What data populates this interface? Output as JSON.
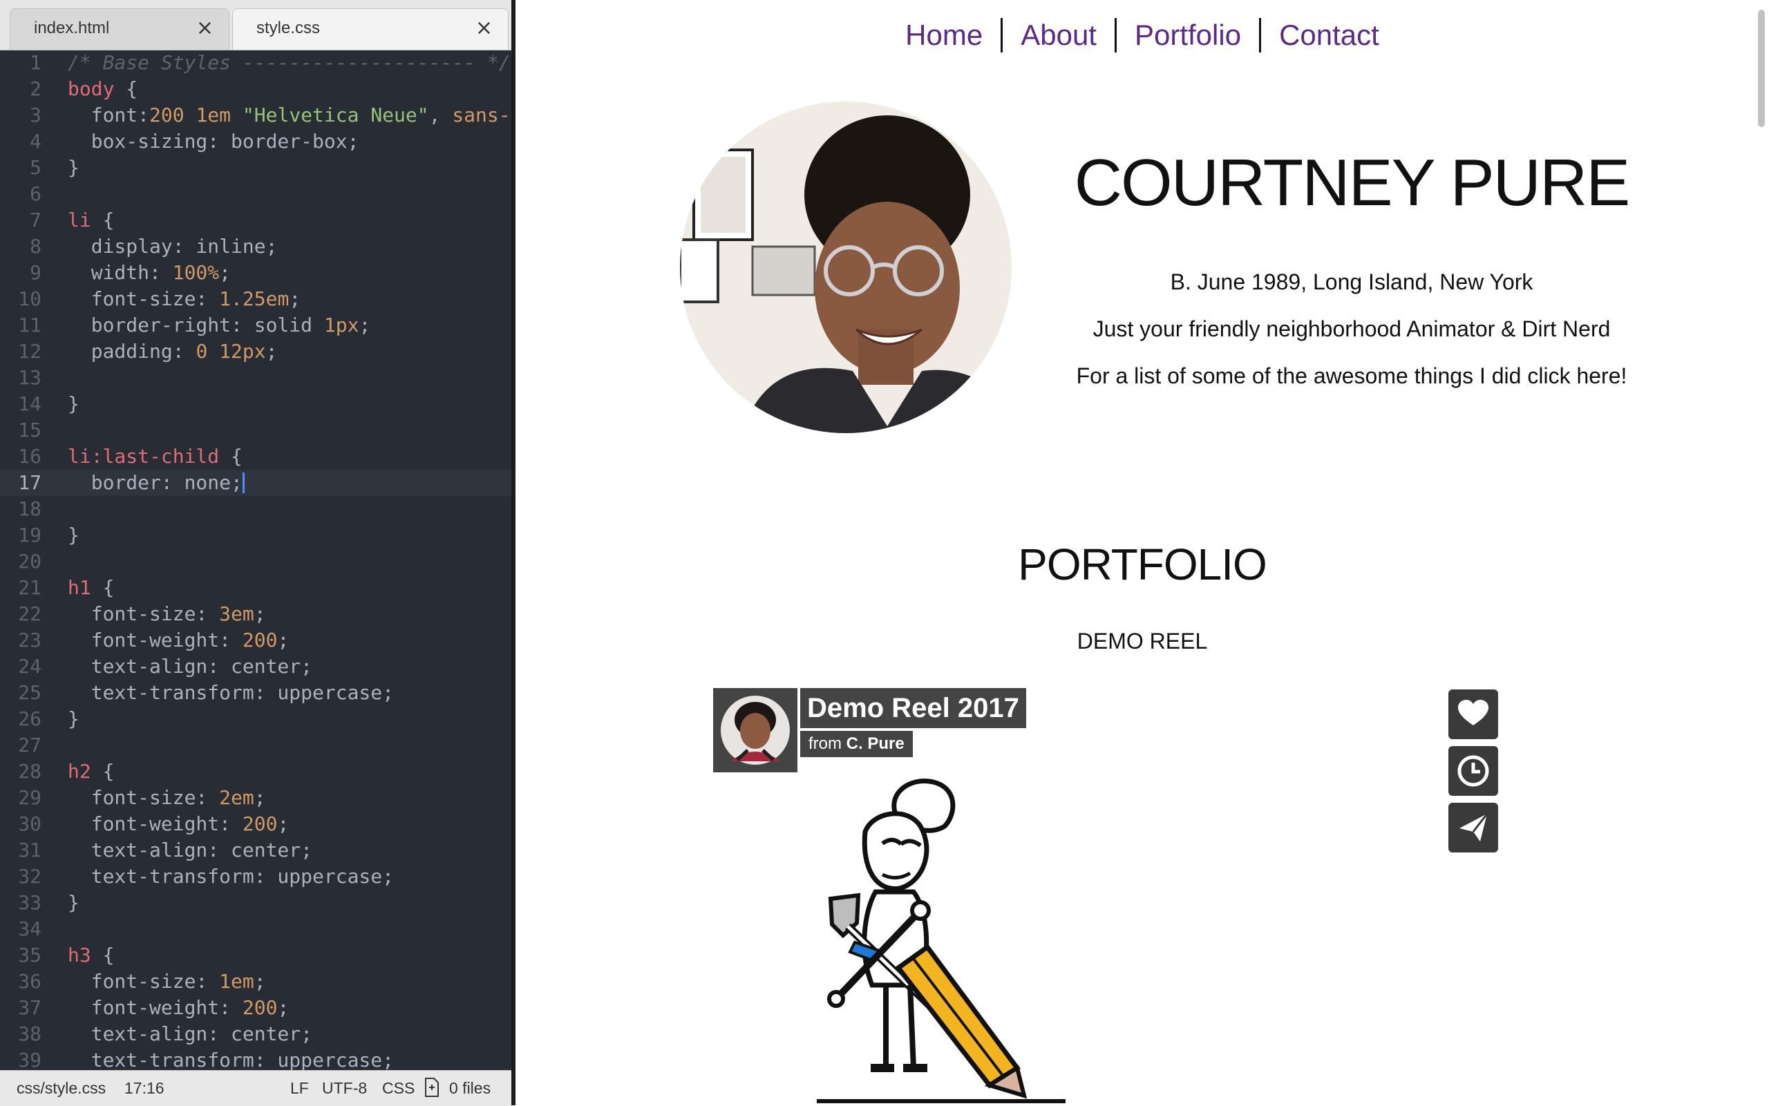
{
  "editor": {
    "tabs": [
      {
        "label": "index.html",
        "close": "×"
      },
      {
        "label": "style.css",
        "close": "×"
      }
    ],
    "lines": [
      {
        "n": "1",
        "parts": [
          {
            "c": "cm",
            "t": "/* Base Styles -------------------- */"
          }
        ]
      },
      {
        "n": "2",
        "parts": [
          {
            "c": "sel",
            "t": "body"
          },
          {
            "c": "",
            "t": " {"
          }
        ]
      },
      {
        "n": "3",
        "parts": [
          {
            "c": "",
            "t": "  font:"
          },
          {
            "c": "num",
            "t": "200 1em"
          },
          {
            "c": "",
            "t": " "
          },
          {
            "c": "str",
            "t": "\"Helvetica Neue\""
          },
          {
            "c": "",
            "t": ", "
          },
          {
            "c": "num",
            "t": "sans-ser"
          }
        ]
      },
      {
        "n": "4",
        "parts": [
          {
            "c": "",
            "t": "  box-sizing: border-box;"
          }
        ]
      },
      {
        "n": "5",
        "parts": [
          {
            "c": "",
            "t": "}"
          }
        ]
      },
      {
        "n": "6",
        "parts": []
      },
      {
        "n": "7",
        "parts": [
          {
            "c": "sel",
            "t": "li"
          },
          {
            "c": "",
            "t": " {"
          }
        ]
      },
      {
        "n": "8",
        "parts": [
          {
            "c": "",
            "t": "  display: inline;"
          }
        ]
      },
      {
        "n": "9",
        "parts": [
          {
            "c": "",
            "t": "  width: "
          },
          {
            "c": "num",
            "t": "100%"
          },
          {
            "c": "",
            "t": ";"
          }
        ]
      },
      {
        "n": "10",
        "parts": [
          {
            "c": "",
            "t": "  font-size: "
          },
          {
            "c": "num",
            "t": "1.25em"
          },
          {
            "c": "",
            "t": ";"
          }
        ]
      },
      {
        "n": "11",
        "parts": [
          {
            "c": "",
            "t": "  border-right: solid "
          },
          {
            "c": "num",
            "t": "1px"
          },
          {
            "c": "",
            "t": ";"
          }
        ]
      },
      {
        "n": "12",
        "parts": [
          {
            "c": "",
            "t": "  padding: "
          },
          {
            "c": "num",
            "t": "0 12px"
          },
          {
            "c": "",
            "t": ";"
          }
        ]
      },
      {
        "n": "13",
        "parts": []
      },
      {
        "n": "14",
        "parts": [
          {
            "c": "",
            "t": "}"
          }
        ]
      },
      {
        "n": "15",
        "parts": []
      },
      {
        "n": "16",
        "parts": [
          {
            "c": "sel",
            "t": "li:last-child"
          },
          {
            "c": "",
            "t": " {"
          }
        ]
      },
      {
        "n": "17",
        "parts": [
          {
            "c": "",
            "t": "  border: none;"
          }
        ],
        "current": true
      },
      {
        "n": "18",
        "parts": []
      },
      {
        "n": "19",
        "parts": [
          {
            "c": "",
            "t": "}"
          }
        ]
      },
      {
        "n": "20",
        "parts": []
      },
      {
        "n": "21",
        "parts": [
          {
            "c": "sel",
            "t": "h1"
          },
          {
            "c": "",
            "t": " {"
          }
        ]
      },
      {
        "n": "22",
        "parts": [
          {
            "c": "",
            "t": "  font-size: "
          },
          {
            "c": "num",
            "t": "3em"
          },
          {
            "c": "",
            "t": ";"
          }
        ]
      },
      {
        "n": "23",
        "parts": [
          {
            "c": "",
            "t": "  font-weight: "
          },
          {
            "c": "num",
            "t": "200"
          },
          {
            "c": "",
            "t": ";"
          }
        ]
      },
      {
        "n": "24",
        "parts": [
          {
            "c": "",
            "t": "  text-align: center;"
          }
        ]
      },
      {
        "n": "25",
        "parts": [
          {
            "c": "",
            "t": "  text-transform: uppercase;"
          }
        ]
      },
      {
        "n": "26",
        "parts": [
          {
            "c": "",
            "t": "}"
          }
        ]
      },
      {
        "n": "27",
        "parts": []
      },
      {
        "n": "28",
        "parts": [
          {
            "c": "sel",
            "t": "h2"
          },
          {
            "c": "",
            "t": " {"
          }
        ]
      },
      {
        "n": "29",
        "parts": [
          {
            "c": "",
            "t": "  font-size: "
          },
          {
            "c": "num",
            "t": "2em"
          },
          {
            "c": "",
            "t": ";"
          }
        ]
      },
      {
        "n": "30",
        "parts": [
          {
            "c": "",
            "t": "  font-weight: "
          },
          {
            "c": "num",
            "t": "200"
          },
          {
            "c": "",
            "t": ";"
          }
        ]
      },
      {
        "n": "31",
        "parts": [
          {
            "c": "",
            "t": "  text-align: center;"
          }
        ]
      },
      {
        "n": "32",
        "parts": [
          {
            "c": "",
            "t": "  text-transform: uppercase;"
          }
        ]
      },
      {
        "n": "33",
        "parts": [
          {
            "c": "",
            "t": "}"
          }
        ]
      },
      {
        "n": "34",
        "parts": []
      },
      {
        "n": "35",
        "parts": [
          {
            "c": "sel",
            "t": "h3"
          },
          {
            "c": "",
            "t": " {"
          }
        ]
      },
      {
        "n": "36",
        "parts": [
          {
            "c": "",
            "t": "  font-size: "
          },
          {
            "c": "num",
            "t": "1em"
          },
          {
            "c": "",
            "t": ";"
          }
        ]
      },
      {
        "n": "37",
        "parts": [
          {
            "c": "",
            "t": "  font-weight: "
          },
          {
            "c": "num",
            "t": "200"
          },
          {
            "c": "",
            "t": ";"
          }
        ]
      },
      {
        "n": "38",
        "parts": [
          {
            "c": "",
            "t": "  text-align: center;"
          }
        ]
      },
      {
        "n": "39",
        "parts": [
          {
            "c": "",
            "t": "  text-transform: uppercase;"
          }
        ]
      }
    ],
    "status": {
      "file": "css/style.css",
      "cursor": "17:16",
      "line_ending": "LF",
      "encoding": "UTF-8",
      "grammar": "CSS",
      "files": "0 files",
      "files_icon": "file-icon"
    }
  },
  "page": {
    "nav": [
      "Home",
      "About",
      "Portfolio",
      "Contact"
    ],
    "name": "COURTNEY PURE",
    "bio": [
      "B. June 1989, Long Island, New York",
      "Just your friendly neighborhood Animator & Dirt Nerd",
      "For a list of some of the awesome things I did click here!"
    ],
    "portfolio_heading": "PORTFOLIO",
    "demo_heading": "DEMO REEL",
    "video": {
      "title": "Demo Reel 2017",
      "from_prefix": "from",
      "author": "C. Pure",
      "buttons": [
        "heart-icon",
        "clock-icon",
        "send-icon"
      ]
    }
  }
}
